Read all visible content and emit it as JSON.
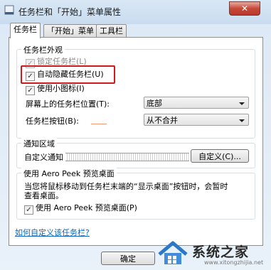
{
  "window": {
    "title": "任务栏和「开始」菜单属性",
    "close_glyph": "✕"
  },
  "tabs": [
    {
      "label": "任务栏"
    },
    {
      "label": "「开始」菜单"
    },
    {
      "label": "工具栏"
    }
  ],
  "appearance": {
    "title": "任务栏外观",
    "lock": {
      "label": "锁定任务栏(L)"
    },
    "autohide": {
      "label": "自动隐藏任务栏(U)"
    },
    "small_icons": {
      "label": "使用小图标(I)"
    },
    "position": {
      "label": "屏幕上的任务栏位置(T):",
      "value": "底部"
    },
    "buttons": {
      "label": "任务栏按钮(B):",
      "value": "从不合并"
    }
  },
  "notify": {
    "title": "通知区域",
    "text": "自定义通知",
    "button": "自定义(C)..."
  },
  "peek": {
    "title": "使用 Aero Peek 预览桌面",
    "desc_line1": "当您将鼠标移动到任务栏末端的“显示桌面”按钮时，会暂时",
    "desc_line2": "查看桌面。",
    "checkbox": {
      "label": "使用 Aero Peek 预览桌面(P)"
    }
  },
  "link": "如何自定义该任务栏?",
  "footer": {
    "ok": "确定"
  },
  "watermark": {
    "text": "系统之家",
    "url": "www.xitongzhijia.net"
  },
  "colors": {
    "highlight": "#cf1b1b",
    "link": "#0b66c3"
  }
}
